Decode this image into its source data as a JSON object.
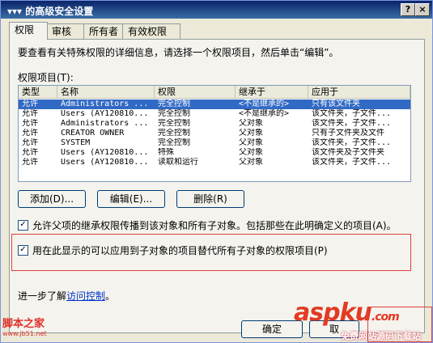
{
  "window": {
    "title": "▾▾▾ 的高级安全设置",
    "help_glyph": "?",
    "close_glyph": "×"
  },
  "tabs": [
    {
      "label": "权限"
    },
    {
      "label": "审核"
    },
    {
      "label": "所有者"
    },
    {
      "label": "有效权限"
    }
  ],
  "description": "要查看有关特殊权限的详细信息，请选择一个权限项目，然后单击“编辑”。",
  "list_label": "权限项目(T):",
  "columns": [
    "类型",
    "名称",
    "权限",
    "继承于",
    "应用于"
  ],
  "rows": [
    {
      "type": "允许",
      "name": "Administrators ...",
      "perm": "完全控制",
      "inherit": "<不是继承的>",
      "apply": "只有该文件夹",
      "selected": true
    },
    {
      "type": "允许",
      "name": "Users (AY120810...",
      "perm": "完全控制",
      "inherit": "<不是继承的>",
      "apply": "该文件夹，子文件..."
    },
    {
      "type": "允许",
      "name": "Administrators ...",
      "perm": "完全控制",
      "inherit": "父对象",
      "apply": "该文件夹，子文件..."
    },
    {
      "type": "允许",
      "name": "CREATOR OWNER",
      "perm": "完全控制",
      "inherit": "父对象",
      "apply": "只有子文件夹及文件"
    },
    {
      "type": "允许",
      "name": "SYSTEM",
      "perm": "完全控制",
      "inherit": "父对象",
      "apply": "该文件夹，子文件..."
    },
    {
      "type": "允许",
      "name": "Users (AY120810...",
      "perm": "特殊",
      "inherit": "父对象",
      "apply": "该文件夹及子文件夹"
    },
    {
      "type": "允许",
      "name": "Users (AY120810...",
      "perm": "读取和运行",
      "inherit": "父对象",
      "apply": "该文件夹，子文件..."
    }
  ],
  "buttons": {
    "add": "添加(D)...",
    "edit": "编辑(E)...",
    "remove": "删除(R)",
    "ok": "确定",
    "cancel": "取"
  },
  "checkbox1": {
    "label": "允许父项的继承权限传播到该对象和所有子对象。包括那些在此明确定义的项目(A)。",
    "checked": true
  },
  "checkbox2": {
    "label": "用在此显示的可以应用到子对象的项目替代所有子对象的权限项目(P)",
    "checked": true
  },
  "learn_more": {
    "prefix": "进一步了解",
    "link": "访问控制",
    "suffix": "。"
  },
  "watermarks": {
    "left_logo": "脚本之家",
    "left_url": "www.jb51.net",
    "right_logo": "aspku",
    "right_com": ".com",
    "right_sub": "免费网站源码下载站"
  }
}
